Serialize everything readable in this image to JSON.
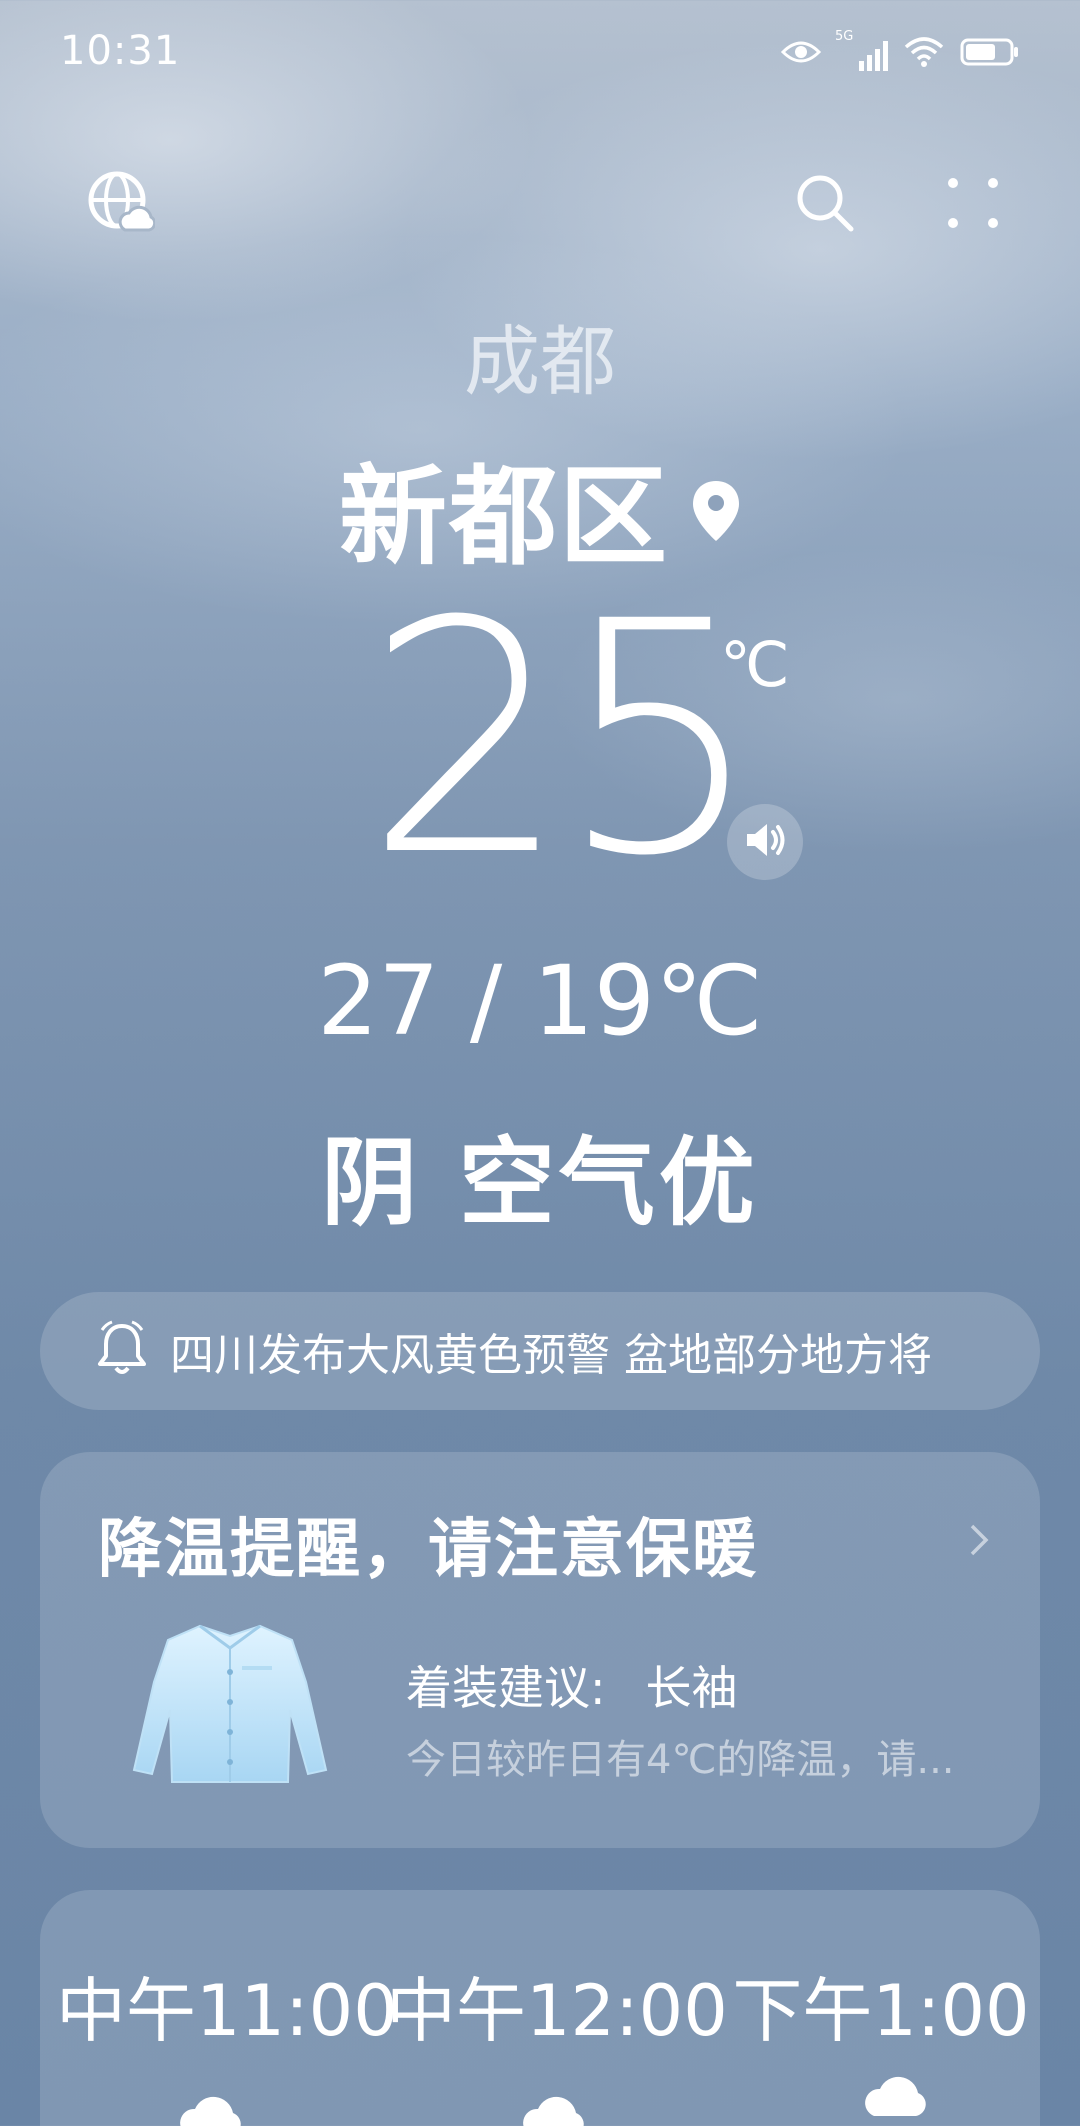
{
  "status_bar": {
    "time": "10:31",
    "network_label": "5G",
    "battery_level_fraction": 0.7
  },
  "header": {
    "left_icon": "globe-weather-icon",
    "search_icon": "search-icon",
    "more_icon": "four-dots-menu-icon"
  },
  "location": {
    "city": "成都",
    "district": "新都区"
  },
  "current": {
    "temperature": "25",
    "unit": "℃",
    "high_low": "27 / 19℃",
    "condition": "阴 空气优"
  },
  "alert": {
    "text": "四川发布大风黄色预警 盆地部分地方将"
  },
  "reminder": {
    "title": "降温提醒，请注意保暖",
    "dress_label": "着装建议:",
    "dress_value": "长袖",
    "description": "今日较昨日有4℃的降温，请..."
  },
  "hourly": [
    {
      "time": "中午11:00",
      "icon": "cloudy-icon"
    },
    {
      "time": "中午12:00",
      "icon": "cloudy-icon"
    },
    {
      "time": "下午1:00",
      "icon": "cloudy-icon"
    }
  ],
  "colors": {
    "background_top": "#b5c1d0",
    "background_bottom": "#6a85a6",
    "card": "rgba(255,255,255,0.15)",
    "text": "#ffffff"
  }
}
